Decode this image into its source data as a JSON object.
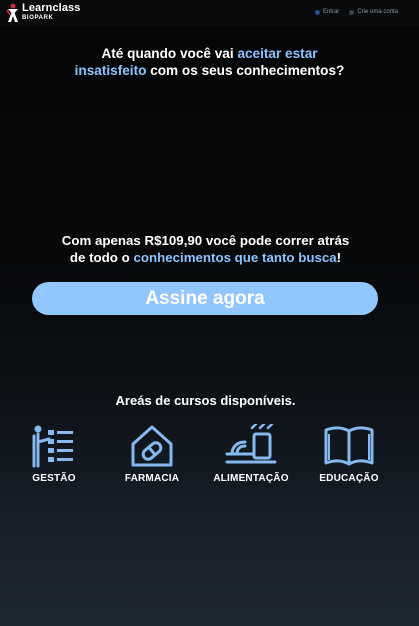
{
  "brand": {
    "name": "Learnclass",
    "sub": "BIOPARK"
  },
  "nav": {
    "login": "Entrar",
    "signup": "Crie uma conta"
  },
  "headline": {
    "p1": "Até quando você vai ",
    "h1": "aceitar estar",
    "h2": "insatisfeito",
    "p2": " com os seus conhecimentos?"
  },
  "offer": {
    "line1": "Com apenas R$109,90 você pode correr atrás",
    "p2": "de todo o ",
    "h": "conhecimentos que tanto busca",
    "p3": "!"
  },
  "cta": {
    "label": "Assine agora"
  },
  "areas": {
    "title": "Areás de cursos disponíveis.",
    "items": [
      {
        "label": "GESTÃO",
        "icon": "management-icon"
      },
      {
        "label": "FARMACIA",
        "icon": "pharmacy-icon"
      },
      {
        "label": "ALIMENTAÇÃO",
        "icon": "food-icon"
      },
      {
        "label": "EDUCAÇÃO",
        "icon": "book-icon"
      }
    ]
  },
  "colors": {
    "accent": "#92c6ff",
    "highlight": "#8ec3ff",
    "icon": "#86b9ef",
    "logo_red": "#d7263d"
  }
}
